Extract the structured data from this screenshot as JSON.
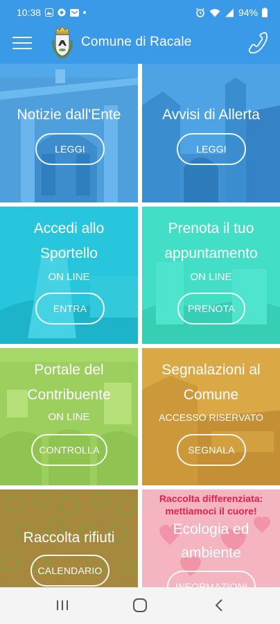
{
  "status_bar": {
    "time": "10:38",
    "battery": "94%"
  },
  "app_bar": {
    "title": "Comune di Racale",
    "icons": {
      "menu": "hamburger-menu-icon",
      "phone": "phone-icon",
      "logo": "coat-of-arms-logo"
    }
  },
  "colors": {
    "primary": "#3a9ae8",
    "tile_blue": "#3f9fe6",
    "tile_teal": "#1fc8d8",
    "tile_green": "#3fe0c4",
    "tile_lime": "#a6d86a",
    "tile_ochre": "#d8a845",
    "tile_brown": "#a88a42",
    "tile_pink": "#f4b0bd",
    "banner_red": "#e6204c"
  },
  "tiles": [
    {
      "title_line1": "Notizie dall'Ente",
      "button": "LEGGI"
    },
    {
      "title_line1": "Avvisi di Allerta",
      "button": "LEGGI"
    },
    {
      "title_line1": "Accedi allo",
      "title_line2": "Sportello",
      "subtitle": "ON LINE",
      "button": "ENTRA"
    },
    {
      "title_line1": "Prenota il tuo",
      "title_line2": "appuntamento",
      "subtitle": "ON LINE",
      "button": "PRENOTA"
    },
    {
      "title_line1": "Portale del",
      "title_line2": "Contribuente",
      "subtitle": "ON LINE",
      "button": "CONTROLLA"
    },
    {
      "title_line1": "Segnalazioni al",
      "title_line2": "Comune",
      "subtitle": "ACCESSO RISERVATO",
      "button": "SEGNALA"
    },
    {
      "title_line1": "Raccolta rifiuti",
      "button": "CALENDARIO"
    },
    {
      "banner_line1": "Raccolta differenziata:",
      "banner_line2": "mettiamoci il cuore!",
      "title_line1": "Ecologia ed",
      "title_line2": "ambiente",
      "button": "INFORMAZIONI"
    }
  ],
  "nav_bar": {
    "icons": {
      "recents": "recent-apps-icon",
      "home": "home-icon",
      "back": "back-icon"
    }
  }
}
